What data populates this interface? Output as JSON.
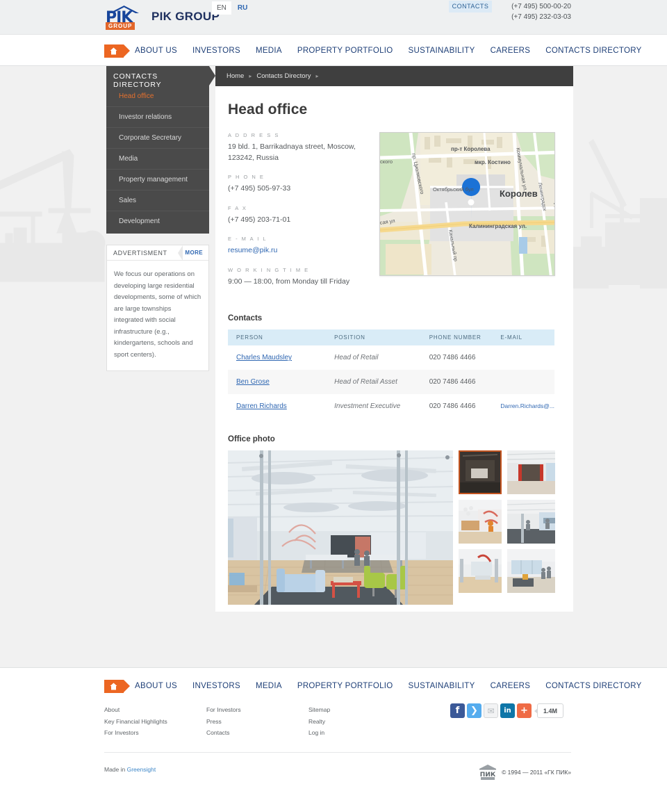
{
  "header": {
    "logo": {
      "mark_text": "PIK",
      "badge": "GROUP",
      "wordmark": "PIK GROUP"
    },
    "languages": [
      {
        "code": "EN",
        "active": true
      },
      {
        "code": "RU",
        "active": false
      }
    ],
    "contacts_button": "CONTACTS",
    "phones": [
      "(+7 495) 500-00-20",
      "(+7 495) 232-03-03"
    ]
  },
  "mainnav": {
    "home_label": "Home",
    "items": [
      "ABOUT US",
      "INVESTORS",
      "MEDIA",
      "PROPERTY PORTFOLIO",
      "SUSTAINABILITY",
      "CAREERS",
      "CONTACTS DIRECTORY"
    ]
  },
  "sidebar": {
    "title": "CONTACTS DIRECTORY",
    "items": [
      {
        "label": "Head office",
        "active": true
      },
      {
        "label": "Investor relations",
        "active": false
      },
      {
        "label": "Corporate Secretary",
        "active": false
      },
      {
        "label": "Media",
        "active": false
      },
      {
        "label": "Property management",
        "active": false
      },
      {
        "label": "Sales",
        "active": false
      },
      {
        "label": "Development",
        "active": false
      }
    ],
    "advertisement": {
      "title": "ADVERTISMENT",
      "more_label": "MORE",
      "text": "We focus our operations on developing large residential developments, some of which are large townships integrated with social infrastructure (e.g., kindergartens, schools and sport centers)."
    }
  },
  "breadcrumb": {
    "items": [
      "Home",
      "Contacts Directory"
    ],
    "separator": "▸"
  },
  "main": {
    "page_title": "Head office",
    "fields": [
      {
        "label": "A D D R E S S",
        "value": "19 bld. 1, Barrikadnaya street, Moscow, 123242, Russia",
        "link": false
      },
      {
        "label": "P H O N E",
        "value": "(+7 495) 505-97-33",
        "link": false
      },
      {
        "label": "F A X",
        "value": "(+7 495) 203-71-01",
        "link": false
      },
      {
        "label": "E - M A I L",
        "value": "resume@pik.ru",
        "link": true
      },
      {
        "label": "W O R K I N G   T I M E",
        "value": "9:00 — 18:00, from Monday till Friday",
        "link": false
      }
    ],
    "map": {
      "city_label": "Королев",
      "labels": [
        "пр-т Королева",
        "мкр. Костино",
        "Октябрьский бул",
        "Калининградская ул.",
        "пр. Циолковского",
        "Коммунальная ул.",
        "Канальный пр",
        "ского",
        "сая ул",
        "у.",
        "п."
      ]
    },
    "contacts_section": {
      "title": "Contacts",
      "columns": [
        "PERSON",
        "POSITION",
        "PHONE NUMBER",
        "E-MAIL"
      ],
      "rows": [
        {
          "person": "Charles Maudsley",
          "position": "Head of Retail",
          "phone": "020 7486 4466",
          "email": ""
        },
        {
          "person": "Ben Grose",
          "position": "Head of Retail Asset",
          "phone": "020 7486 4466",
          "email": ""
        },
        {
          "person": "Darren Richards",
          "position": "Investment Executive",
          "phone": "020 7486 4466",
          "email": "Darren.Richards@..."
        }
      ]
    },
    "photo_section": {
      "title": "Office photo",
      "thumb_count": 6,
      "selected_thumb_index": 0
    }
  },
  "footer": {
    "nav": [
      "ABOUT US",
      "INVESTORS",
      "MEDIA",
      "PROPERTY PORTFOLIO",
      "SUSTAINABILITY",
      "CAREERS",
      "CONTACTS DIRECTORY"
    ],
    "link_columns": [
      [
        "About",
        "Key Financial Highlights",
        "For Investors"
      ],
      [
        "For Investors",
        "Press",
        "Contacts"
      ],
      [
        "Sitemap",
        "Realty",
        "Log in"
      ]
    ],
    "social": [
      {
        "name": "facebook",
        "glyph": "f"
      },
      {
        "name": "twitter",
        "glyph": "❯"
      },
      {
        "name": "email",
        "glyph": "✉"
      },
      {
        "name": "linkedin",
        "glyph": "in"
      },
      {
        "name": "share",
        "glyph": "+"
      }
    ],
    "share_count": "1.4M",
    "made_in_prefix": "Made in ",
    "made_in_link": "Greensight",
    "copyright": "© 1994 — 2011 «ГК ПИК»",
    "copyright_mark": "ПИК"
  },
  "colors": {
    "accent_orange": "#ec6622",
    "nav_blue": "#1e3f77",
    "sidebar_dark": "#4a4a4a",
    "crumb_dark": "#3f3f3f",
    "table_header": "#d9ecf7",
    "link_blue": "#2f67b2"
  }
}
